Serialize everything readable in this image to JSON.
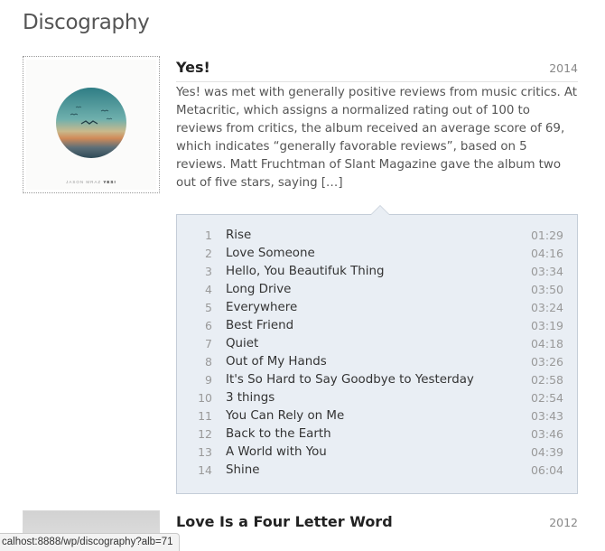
{
  "page": {
    "title": "Discography"
  },
  "albums": [
    {
      "title": "Yes!",
      "year": "2014",
      "cover": {
        "artist": "JASON MRAZ",
        "title": "YES!"
      },
      "description": "Yes! was met with generally positive reviews from music critics. At Metacritic, which assigns a normalized rating out of 100 to reviews from critics, the album received an average score of 69, which indi­cates “generally favorable reviews”, based on 5 reviews. Matt Fruchtman of Slant Magazine gave the album two out of five stars, saying […]",
      "tracks": [
        {
          "num": "1",
          "name": "Rise",
          "duration": "01:29"
        },
        {
          "num": "2",
          "name": "Love Someone",
          "duration": "04:16"
        },
        {
          "num": "3",
          "name": "Hello, You Beautifuk Thing",
          "duration": "03:34"
        },
        {
          "num": "4",
          "name": "Long Drive",
          "duration": "03:50"
        },
        {
          "num": "5",
          "name": "Everywhere",
          "duration": "03:24"
        },
        {
          "num": "6",
          "name": "Best Friend",
          "duration": "03:19"
        },
        {
          "num": "7",
          "name": "Quiet",
          "duration": "04:18"
        },
        {
          "num": "8",
          "name": "Out of My Hands",
          "duration": "03:26"
        },
        {
          "num": "9",
          "name": "It's So Hard to Say Goodbye to Yesterday",
          "duration": "02:58"
        },
        {
          "num": "10",
          "name": "3 things",
          "duration": "02:54"
        },
        {
          "num": "11",
          "name": "You Can Rely on Me",
          "duration": "03:43"
        },
        {
          "num": "12",
          "name": "Back to the Earth",
          "duration": "03:46"
        },
        {
          "num": "13",
          "name": "A World with You",
          "duration": "04:39"
        },
        {
          "num": "14",
          "name": "Shine",
          "duration": "06:04"
        }
      ]
    },
    {
      "title": "Love Is a Four Letter Word",
      "year": "2012"
    }
  ],
  "status_bar": {
    "url": "calhost:8888/wp/discography?alb=71"
  },
  "colors": {
    "tracklist_bg": "#e9eef4",
    "tracklist_border": "#c4cdd8",
    "title": "#222222"
  }
}
